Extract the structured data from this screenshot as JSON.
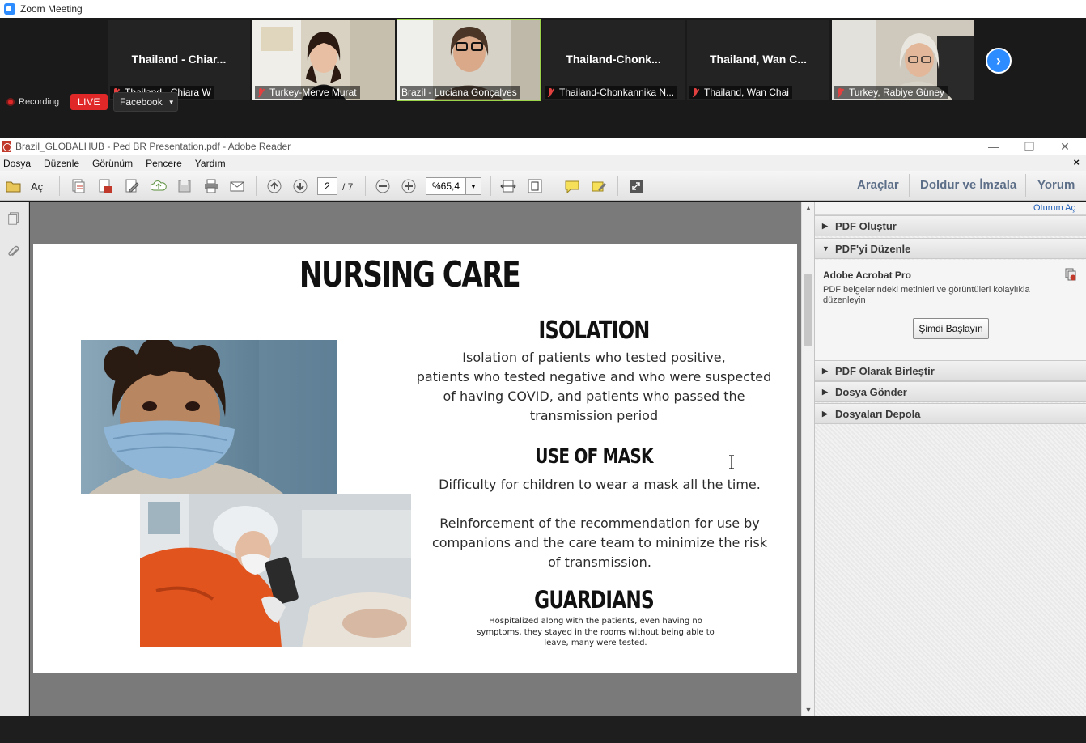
{
  "zoom": {
    "window_title": "Zoom Meeting",
    "participants": [
      {
        "display": "Thailand - Chiar...",
        "label": "Thailand - Chiara W",
        "video": false
      },
      {
        "display": "",
        "label": "Turkey-Merve Murat",
        "video": true
      },
      {
        "display": "",
        "label": "Brazil - Luciana Gonçalves",
        "video": true,
        "active_speaker": true
      },
      {
        "display": "Thailand-Chonk...",
        "label": "Thailand-Chonkannika N...",
        "video": false
      },
      {
        "display": "Thailand, Wan C...",
        "label": "Thailand, Wan Chai",
        "video": false
      },
      {
        "display": "",
        "label": "Turkey, Rabiye Güney",
        "video": true
      }
    ],
    "next_icon": "chevron-right-icon",
    "recording_label": "Recording",
    "live_label": "LIVE",
    "stream_target": "Facebook",
    "colors": {
      "accent": "#2d8cff",
      "live": "#e02828",
      "active_border": "#9bd34a"
    }
  },
  "adobe": {
    "window_title": "Brazil_GLOBALHUB - Ped BR Presentation.pdf - Adobe Reader",
    "window_controls": {
      "minimize": "—",
      "restore": "❐",
      "close": "✕"
    },
    "menu": [
      "Dosya",
      "Düzenle",
      "Görünüm",
      "Pencere",
      "Yardım"
    ],
    "menu_close": "×",
    "toolbar": {
      "open_label": "Aç",
      "page_current": "2",
      "page_total": "/ 7",
      "zoom_value": "%65,4",
      "tools_label": "Araçlar",
      "fill_sign_label": "Doldur ve İmzala",
      "comment_label": "Yorum"
    },
    "panel": {
      "login_label": "Oturum Aç",
      "sections": [
        {
          "label": "PDF Oluştur",
          "expanded": false
        },
        {
          "label": "PDF'yi Düzenle",
          "expanded": true
        },
        {
          "label": "PDF Olarak Birleştir",
          "expanded": false
        },
        {
          "label": "Dosya Gönder",
          "expanded": false
        },
        {
          "label": "Dosyaları Depola",
          "expanded": false
        }
      ],
      "edit_product": "Adobe Acrobat Pro",
      "edit_description": "PDF belgelerindeki metinleri ve görüntüleri kolaylıkla düzenleyin",
      "start_button": "Şimdi Başlayın"
    }
  },
  "slide": {
    "title": "NURSING CARE",
    "sections": [
      {
        "heading": "ISOLATION",
        "lines": [
          "Isolation of patients who tested positive,",
          "patients who tested negative and who were suspected",
          "of having COVID, and patients who passed the",
          "transmission period"
        ]
      },
      {
        "heading": "USE OF MASK",
        "lines": [
          "Difficulty for children to wear a mask all the time.",
          "",
          "Reinforcement of the recommendation for use by",
          "companions and the care team to minimize the risk",
          "of transmission."
        ]
      },
      {
        "heading": "GUARDIANS",
        "lines": [
          "Hospitalized along with the patients, even having no",
          "symptoms, they stayed in the rooms without being able to",
          "leave, many were tested."
        ]
      }
    ]
  }
}
